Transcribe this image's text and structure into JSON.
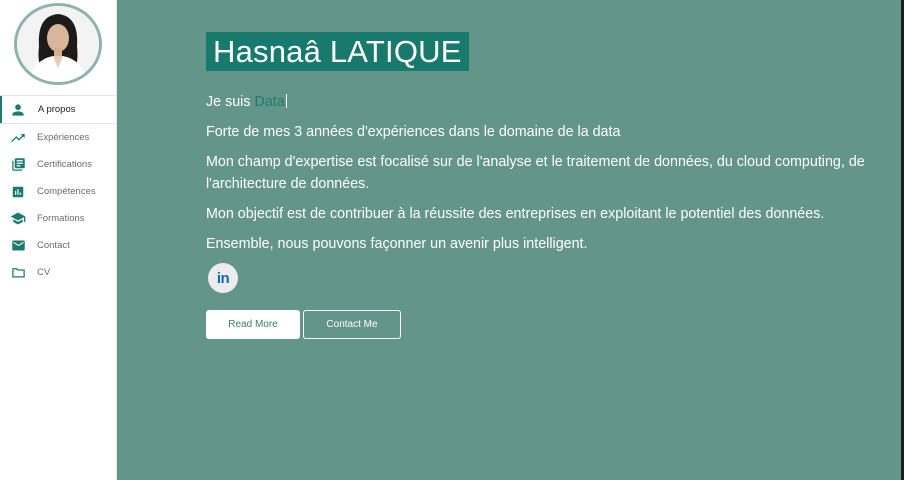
{
  "sidebar": {
    "avatar_alt": "Profile photo",
    "items": [
      {
        "label": "A propos",
        "icon": "person-icon",
        "active": true
      },
      {
        "label": "Expériences",
        "icon": "trending-up-icon",
        "active": false
      },
      {
        "label": "Certifications",
        "icon": "library-books-icon",
        "active": false
      },
      {
        "label": "Compétences",
        "icon": "bar-chart-icon",
        "active": false
      },
      {
        "label": "Formations",
        "icon": "graduation-cap-icon",
        "active": false
      },
      {
        "label": "Contact",
        "icon": "mail-icon",
        "active": false
      },
      {
        "label": "CV",
        "icon": "folder-icon",
        "active": false
      }
    ]
  },
  "hero": {
    "name": "Hasnaâ LATIQUE",
    "intro_prefix": "Je suis ",
    "intro_typed": "Data",
    "paragraphs": [
      "Forte de mes 3 années d'expériences dans le domaine de la data",
      "Mon champ d'expertise est focalisé sur de l'analyse et le traitement de données, du cloud computing, de l'architecture de données.",
      "Mon objectif est de contribuer à la réussite des entreprises en exploitant le potentiel des données.",
      "Ensemble, nous pouvons façonner un avenir plus intelligent."
    ],
    "social_icon": "linkedin-icon",
    "social_label": "in",
    "buttons": {
      "read_more": "Read More",
      "contact_me": "Contact Me"
    }
  },
  "colors": {
    "main_bg": "#63958a",
    "accent": "#177a6c",
    "sidebar_bg": "#ffffff"
  }
}
